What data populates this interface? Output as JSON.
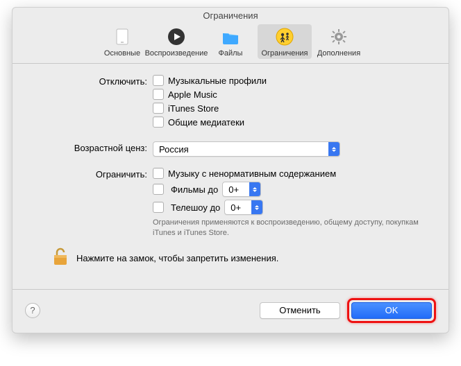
{
  "window": {
    "title": "Ограничения"
  },
  "toolbar": {
    "items": [
      {
        "label": "Основные"
      },
      {
        "label": "Воспроизведение"
      },
      {
        "label": "Файлы"
      },
      {
        "label": "Ограничения"
      },
      {
        "label": "Дополнения"
      }
    ]
  },
  "section_disable": {
    "label": "Отключить:",
    "options": [
      "Музыкальные профили",
      "Apple Music",
      "iTunes Store",
      "Общие медиатеки"
    ]
  },
  "section_age": {
    "label": "Возрастной ценз:",
    "value": "Россия"
  },
  "section_restrict": {
    "label": "Ограничить:",
    "explicit": "Музыку с ненормативным содержанием",
    "movies_label": "Фильмы до",
    "movies_value": "0+",
    "tv_label": "Телешоу до",
    "tv_value": "0+",
    "note": "Ограничения применяются к воспроизведению, общему доступу, покупкам iTunes и iTunes Store."
  },
  "lock": {
    "message": "Нажмите на замок, чтобы запретить изменения."
  },
  "footer": {
    "help": "?",
    "cancel": "Отменить",
    "ok": "OK"
  }
}
